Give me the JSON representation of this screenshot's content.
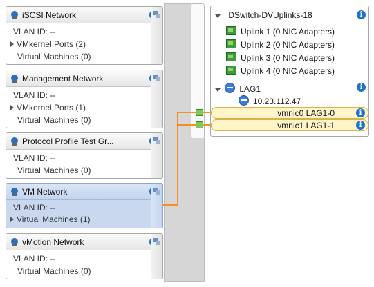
{
  "port_groups": [
    {
      "title": "iSCSI Network",
      "vlan": "VLAN ID: --",
      "line2": "VMkernel Ports (2)",
      "line3": "Virtual Machines (0)"
    },
    {
      "title": "Management Network",
      "vlan": "VLAN ID: --",
      "line2": "VMkernel Ports (1)",
      "line3": "Virtual Machines (0)"
    },
    {
      "title": "Protocol Profile Test Gr...",
      "vlan": "VLAN ID: --",
      "line2": "Virtual Machines (0)"
    },
    {
      "title": "VM Network",
      "vlan": "VLAN ID: --",
      "line2": "Virtual Machines (1)"
    },
    {
      "title": "vMotion Network",
      "vlan": "VLAN ID: --",
      "line2": "Virtual Machines (0)"
    }
  ],
  "uplinks": {
    "title": "DSwitch-DVUplinks-18",
    "items": [
      "Uplink 1 (0 NIC Adapters)",
      "Uplink 2 (0 NIC Adapters)",
      "Uplink 3 (0 NIC Adapters)",
      "Uplink 4 (0 NIC Adapters)"
    ],
    "lag": {
      "label": "LAG1",
      "host": "10.23.112.47",
      "nics": [
        "vmnic0 LAG1-0",
        "vmnic1 LAG1-1"
      ]
    }
  },
  "info_glyph": "i",
  "colors": {
    "accent": "#1f73c9",
    "connection": "#f5901e",
    "selected": "#c9d8ef",
    "highlight": "#fff5c8"
  }
}
